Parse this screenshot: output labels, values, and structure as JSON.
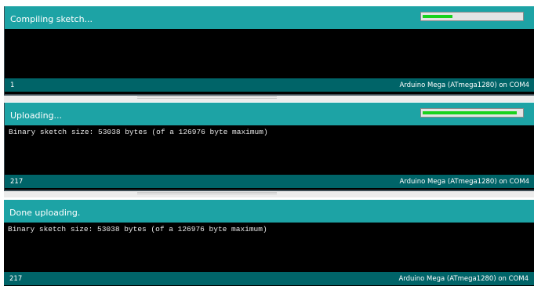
{
  "colors": {
    "status_bar": "#1da3a5",
    "footer_bar": "#006468",
    "console_bg": "#000000",
    "progress_fill": "#19d21d"
  },
  "panels": [
    {
      "status_text": "Compiling sketch...",
      "progress": 0.3,
      "console_line": "",
      "line_number": "1",
      "board": "Arduino Mega (ATmega1280) on COM4"
    },
    {
      "status_text": "Uploading...",
      "progress": 0.95,
      "console_line": "Binary sketch size: 53038 bytes (of a 126976 byte maximum)",
      "line_number": "217",
      "board": "Arduino Mega (ATmega1280) on COM4"
    },
    {
      "status_text": "Done uploading.",
      "console_line": "Binary sketch size: 53038 bytes (of a 126976 byte maximum)",
      "line_number": "217",
      "board": "Arduino Mega (ATmega1280) on COM4"
    }
  ]
}
